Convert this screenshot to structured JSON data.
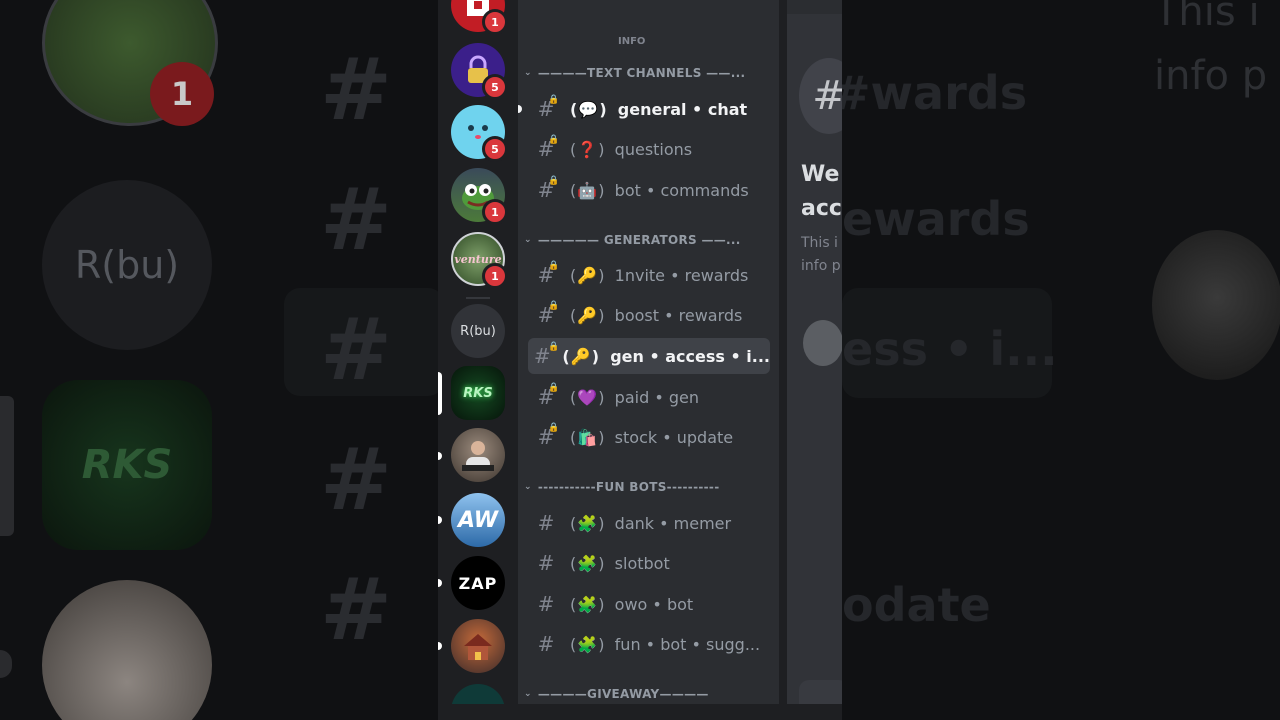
{
  "guilds": [
    {
      "label": "",
      "badge": "1",
      "icon": "roblox-logo-icon",
      "color": "#c21d25"
    },
    {
      "label": "",
      "badge": "5",
      "icon": "lock-icon",
      "color": "#3b1f8a"
    },
    {
      "label": "",
      "badge": "5",
      "icon": "smiley-face-icon",
      "color": "#6fd3ee"
    },
    {
      "label": "",
      "badge": "1",
      "icon": "pepe-frog-icon",
      "color": "#4c7a3a"
    },
    {
      "label": "venture",
      "badge": "1",
      "icon": "venture-logo-icon",
      "color": "#6a8f5a"
    },
    {
      "label": "R(bu)",
      "badge": "",
      "icon": "",
      "color": "#313338"
    },
    {
      "label": "RKS",
      "badge": "",
      "icon": "rks-logo-icon",
      "color": "#0b2a12"
    },
    {
      "label": "",
      "badge": "",
      "icon": "person-avatar-icon",
      "color": "#7b6a5e"
    },
    {
      "label": "AW",
      "badge": "",
      "icon": "aw-logo-icon",
      "color": "#4a88c5"
    },
    {
      "label": "ZAP",
      "badge": "",
      "icon": "",
      "color": "#000000"
    },
    {
      "label": "",
      "badge": "",
      "icon": "house-avatar-icon",
      "color": "#9a4a2a"
    }
  ],
  "categories": {
    "info": "INFO",
    "text_channels": "————TEXT CHANNELS ——...",
    "generators": "————— GENERATORS ——...",
    "fun_bots": "-----------FUN BOTS----------",
    "giveaway": "————GIVEAWAY————"
  },
  "channels": {
    "general": {
      "emoji": "💬",
      "name": "general • chat"
    },
    "questions": {
      "emoji": "❓",
      "name": "questions"
    },
    "bot_commands": {
      "emoji": "🤖",
      "name": "bot • commands"
    },
    "invite_rewards": {
      "emoji": "🔑",
      "name": "1nvite • rewards"
    },
    "boost_rewards": {
      "emoji": "🔑",
      "name": "boost • rewards"
    },
    "gen_access": {
      "emoji": "🔑",
      "name": "gen • access • i..."
    },
    "paid_gen": {
      "emoji": "💜",
      "name": "paid • gen"
    },
    "stock_update": {
      "emoji": "🛍️",
      "name": "stock • update"
    },
    "dank_memer": {
      "emoji": "🧩",
      "name": "dank • memer"
    },
    "slotbot": {
      "emoji": "🧩",
      "name": "slotbot"
    },
    "owo_bot": {
      "emoji": "🧩",
      "name": "owo • bot"
    },
    "fun_bot_sugg": {
      "emoji": "🧩",
      "name": "fun • bot • sugg..."
    }
  },
  "peek": {
    "hash": "#",
    "welcome": "We\nacc",
    "desc": "This i\ninfo p"
  },
  "background": {
    "left_text": "R(bu)",
    "right_rewards": "#wards",
    "right_rewards2": "ewards",
    "right_access": "ess • i...",
    "right_update": "odate",
    "right_top": "This i\ninfo p",
    "left_badge": "1",
    "left_rks": "RKS"
  },
  "colors": {
    "badge": "#da373c",
    "sidebar": "#2b2d31",
    "guild_rail": "#1e1f22",
    "selected": "#3f4248"
  }
}
